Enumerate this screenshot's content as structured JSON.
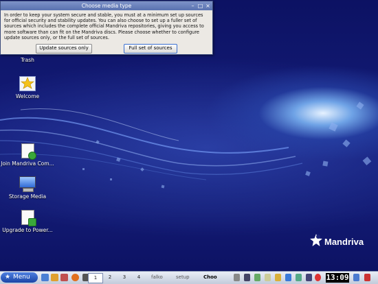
{
  "dialog": {
    "title": "Choose media type",
    "message": "In order to keep your system secure and stable, you must at a minimum set up sources for official security and stability updates. You can also choose to set up a fuller set of sources which includes the complete official Mandriva repositories, giving you access to more software than can fit on the Mandriva discs. Please choose whether to configure update sources only, or the full set of sources.",
    "update_only_label": "Update sources only",
    "full_set_label": "Full set of sources",
    "minimize_glyph": "–",
    "maximize_glyph": "□",
    "close_glyph": "×"
  },
  "desktop": {
    "icons": [
      {
        "label": "Trash",
        "icon": "trash-icon"
      },
      {
        "label": "Welcome",
        "icon": "welcome-star-icon"
      },
      {
        "label": "Join Mandriva Com...",
        "icon": "document-link-icon"
      },
      {
        "label": "Storage Media",
        "icon": "monitor-icon"
      },
      {
        "label": "Upgrade to Power...",
        "icon": "document-upgrade-icon"
      }
    ],
    "logo_text": "Mandriva"
  },
  "taskbar": {
    "menu_label": "Menu",
    "pager": [
      "1",
      "2",
      "3",
      "4"
    ],
    "tasks": [
      "falko",
      "setup",
      "Choo"
    ],
    "clock": "13:09",
    "colors": {
      "menu": "#1b44a6",
      "clock_bg": "#000000"
    }
  }
}
